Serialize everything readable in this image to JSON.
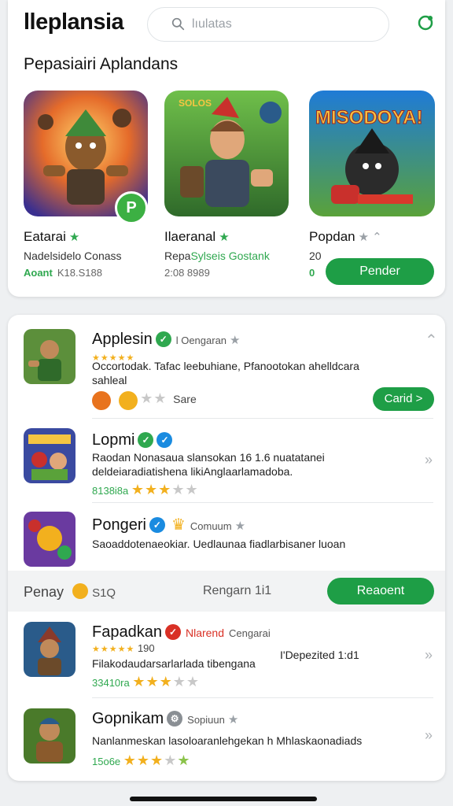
{
  "header": {
    "app_title": "lleplansia",
    "search_placeholder": "lıulatas"
  },
  "featured": {
    "section_title": "Pepasiairi Aplandans",
    "cards": [
      {
        "name": "Eatarai",
        "sub": "Nadelsidelo Conass",
        "meta_green": "Aoant",
        "meta": "K18.S188",
        "badge": "P"
      },
      {
        "name": "Ilaeranal",
        "sub_dark": "Repa",
        "sub_green": "Sylseis Gostank",
        "meta": "2:08 8989"
      },
      {
        "name": "Popdan",
        "sub": "20",
        "meta_green": "0"
      }
    ],
    "button_label": "Pender",
    "card3_banner_text": "MISODOYA!"
  },
  "list": {
    "row1": {
      "name": "Applesin",
      "tag": "l Oengaran",
      "desc": "Occortodak. Tafac leebuhiane, Pfanootokan ahelldcara sahleal",
      "action_label": "Sare",
      "button_label": "Carid >"
    },
    "row2": {
      "name": "Lopmi",
      "desc": "Raodan Nonasaua slansokan 16 1.6 nuatatanei deldeiaradiatishena likiAnglaarlamadoba.",
      "rating_text": "8138i8a"
    },
    "row3": {
      "name": "Pongeri",
      "tag": "Comuum",
      "desc": "Saoaddotenaeokiar. Uedlaunaa fiadlarbisaner luoan"
    },
    "banner": {
      "left_label": "Penay",
      "left_price": "S1Q",
      "middle_label": "Rengarn 1i1",
      "button_label": "Reaoent"
    },
    "row4": {
      "name": "Fapadkan",
      "tag_red": "Nlarend",
      "tag": "Cengarai",
      "rating_small": "190",
      "desc": "Filakodaudarsarlarlada tibengana",
      "right_note": "I'Depezited 1:d1",
      "rating_text": "33410ra"
    },
    "row5": {
      "name": "Gopnikam",
      "tag": "Sopiuun",
      "desc": "Nanlanmeskan lasoloaranlehgekan h Mhlaskaonadiads",
      "rating_text": "15o6e"
    }
  },
  "colors": {
    "accent_green": "#1e9e46",
    "star_yellow": "#f2b01e",
    "verified_blue": "#1a8be0",
    "verified_green": "#2fa84f",
    "badge_red": "#d93025"
  }
}
